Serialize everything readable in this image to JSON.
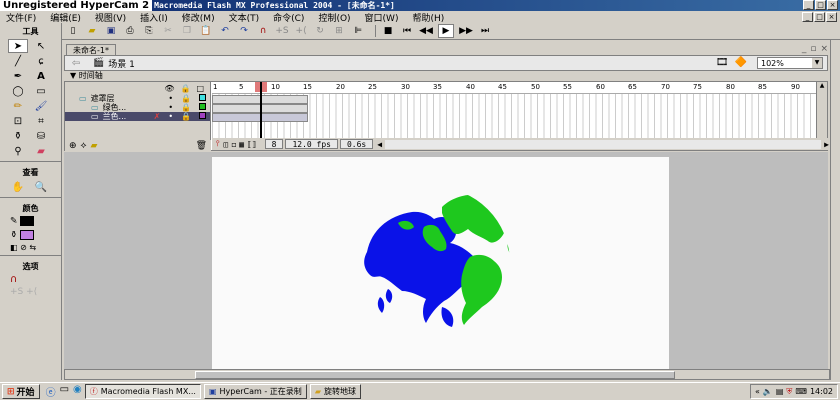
{
  "watermark": "Unregistered HyperCam 2",
  "window_title": "Macromedia Flash MX Professional 2004 - [未命名-1*]",
  "menu": [
    "文件(F)",
    "编辑(E)",
    "视图(V)",
    "插入(I)",
    "修改(M)",
    "文本(T)",
    "命令(C)",
    "控制(O)",
    "窗口(W)",
    "帮助(H)"
  ],
  "tools": {
    "header": "工具",
    "view_header": "查看",
    "color_header": "颜色",
    "options_header": "选项"
  },
  "document": {
    "tab_label": "未命名-1*",
    "scene_label": "场景 1",
    "zoom": "102%"
  },
  "timeline": {
    "header": "▼ 时间轴",
    "layers": [
      {
        "name": "遮罩层",
        "selected": false
      },
      {
        "name": "绿色...",
        "selected": false
      },
      {
        "name": "兰色...",
        "selected": true
      }
    ],
    "ruler_ticks": [
      "1",
      "5",
      "10",
      "15",
      "20",
      "25",
      "30",
      "35",
      "40",
      "45",
      "50",
      "55",
      "60",
      "65",
      "70",
      "75",
      "80",
      "85",
      "90"
    ],
    "current_frame": "8",
    "fps": "12.0 fps",
    "time": "0.6s"
  },
  "taskbar": {
    "start": "开始",
    "tasks": [
      {
        "label": "Macromedia Flash MX...",
        "active": true
      },
      {
        "label": "HyperCam - 正在录制",
        "active": false
      },
      {
        "label": "旋转地球",
        "active": false
      }
    ],
    "clock": "14:02"
  },
  "colors": {
    "globe_blue": "#0a12e8",
    "globe_green": "#1ec81e",
    "title_bar": "#0a246a"
  }
}
